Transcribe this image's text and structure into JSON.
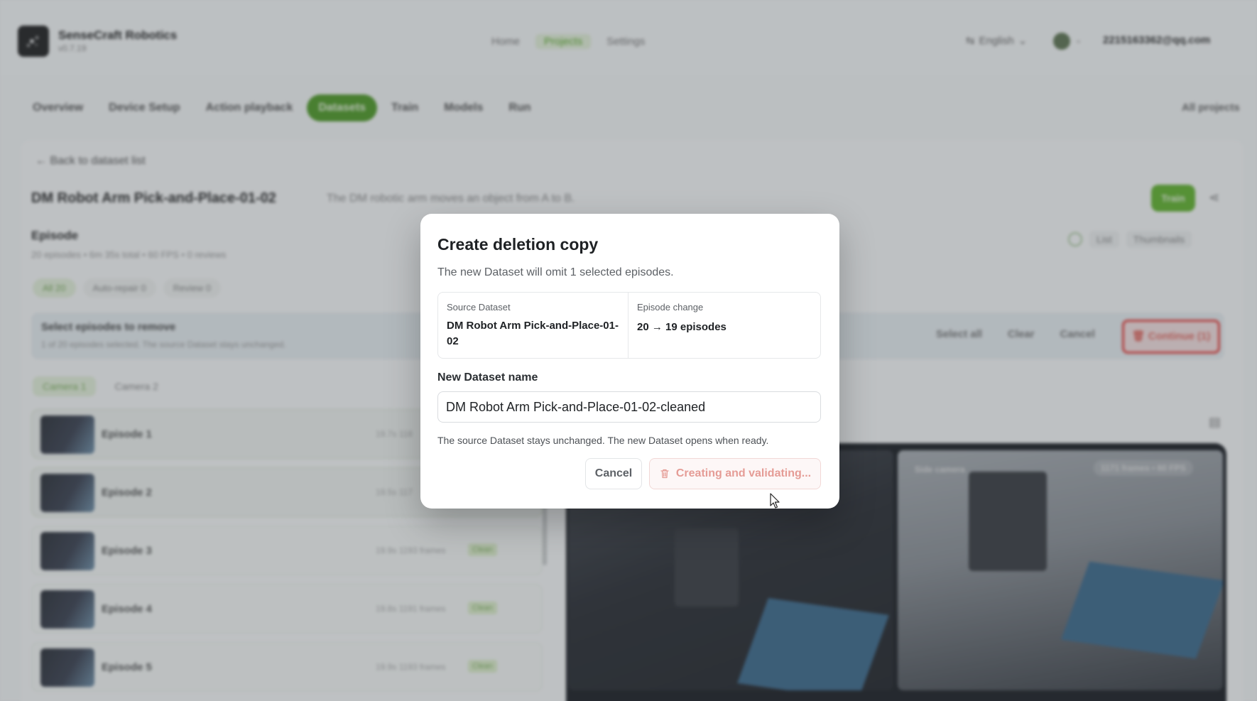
{
  "brand": {
    "name": "SenseCraft Robotics",
    "version": "v0.7.19"
  },
  "nav": [
    "Home",
    "Projects",
    "Settings"
  ],
  "header": {
    "language": "English",
    "email": "2215163362@qq.com"
  },
  "tabs": [
    "Overview",
    "Device Setup",
    "Action playback",
    "Datasets",
    "Train",
    "Models",
    "Run"
  ],
  "all_projects": "All projects",
  "dataset": {
    "back": "← Back to dataset list",
    "title": "DM Robot Arm Pick-and-Place-01-02",
    "description": "The DM robotic arm moves an object from A to B.",
    "train_label": "Train"
  },
  "episode_section": {
    "title": "Episode",
    "meta": "20 episodes • 6m 35s total • 60 FPS • 0 reviews",
    "view_list": "List",
    "view_thumbnails": "Thumbnails",
    "filters": [
      "All 20",
      "Auto-repair 0",
      "Review 0"
    ]
  },
  "selection": {
    "title": "Select episodes to remove",
    "subtitle": "1 of 20 episodes selected. The source Dataset stays unchanged.",
    "select_all": "Select all",
    "clear": "Clear",
    "cancel": "Cancel",
    "continue": "Continue (1)"
  },
  "camera_tabs": [
    "Camera 1",
    "Camera 2"
  ],
  "episodes": [
    {
      "name": "Episode 1",
      "stats": "19.7s  118",
      "badge": ""
    },
    {
      "name": "Episode 2",
      "stats": "19.5s  117",
      "badge": ""
    },
    {
      "name": "Episode 3",
      "stats": "19.9s  1193 frames",
      "badge": "Clean"
    },
    {
      "name": "Episode 4",
      "stats": "19.8s  1191 frames",
      "badge": "Clean"
    },
    {
      "name": "Episode 5",
      "stats": "19.9s  1193 frames",
      "badge": "Clean"
    }
  ],
  "video": {
    "side_camera": "Side camera",
    "frames": "1171 frames • 60 FPS"
  },
  "modal": {
    "title": "Create deletion copy",
    "subtitle": "The new Dataset will omit 1 selected episodes.",
    "source_label": "Source Dataset",
    "source_value": "DM Robot Arm Pick-and-Place-01-02",
    "change_label": "Episode change",
    "change_value": "20 → 19 episodes",
    "name_label": "New Dataset name",
    "name_value": "DM Robot Arm Pick-and-Place-01-02-cleaned",
    "note": "The source Dataset stays unchanged. The new Dataset opens when ready.",
    "cancel_label": "Cancel",
    "create_label": "Creating and validating..."
  },
  "colors": {
    "accent": "#62b32f",
    "danger": "#e43a36",
    "danger_soft": "#e59c96"
  }
}
